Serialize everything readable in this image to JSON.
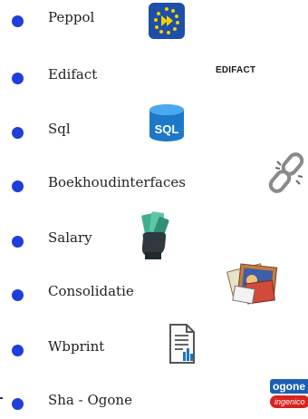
{
  "items": [
    {
      "label": "Peppol",
      "icon": "eu-stars-icon"
    },
    {
      "label": "Edifact",
      "icon": "edifact-logo",
      "logo_text": "EDIFACT"
    },
    {
      "label": "Sql",
      "icon": "database-icon",
      "logo_text": "SQL"
    },
    {
      "label": "Boekhoudinterfaces",
      "icon": "chain-link-icon"
    },
    {
      "label": "Salary",
      "icon": "money-hand-icon"
    },
    {
      "label": "Consolidatie",
      "icon": "photo-stack-icon"
    },
    {
      "label": "Wbprint",
      "icon": "report-chart-icon"
    },
    {
      "label": "Sha - Ogone",
      "icon": "ogone-logo",
      "logo_text": [
        "ogone",
        "ingenico"
      ]
    }
  ],
  "colors": {
    "bullet": "#1f3fd6",
    "eu_blue": "#1d4fa8",
    "eu_yellow": "#f5d000",
    "sql_blue": "#1d78c8",
    "ogone_blue": "#1a5fb4",
    "ogone_red": "#d8231f"
  }
}
